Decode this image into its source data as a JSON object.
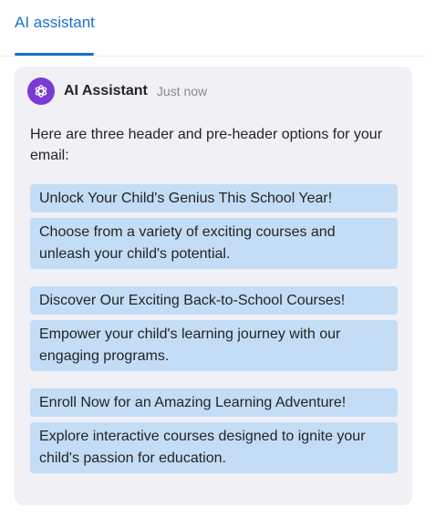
{
  "tabs": [
    {
      "label": "AI assistant",
      "active": true
    }
  ],
  "message": {
    "sender": "AI Assistant",
    "time": "Just now",
    "intro": "Here are three header and pre-header options for your email:",
    "options": [
      {
        "header": "Unlock Your Child's Genius This School Year!",
        "preheader": "Choose from a variety of exciting courses and unleash your child's potential."
      },
      {
        "header": "Discover Our Exciting Back-to-School Courses!",
        "preheader": "Empower your child's learning journey with our engaging programs."
      },
      {
        "header": "Enroll Now for an Amazing Learning Adventure!",
        "preheader": "Explore interactive courses designed to ignite your child's passion for education."
      }
    ]
  },
  "icons": {
    "avatar": "openai-logo-icon"
  },
  "colors": {
    "accent": "#1a6fd0",
    "avatar_bg": "#7a3ad6",
    "option_bg": "#c3ddf6",
    "card_bg": "#f0f0f5"
  }
}
